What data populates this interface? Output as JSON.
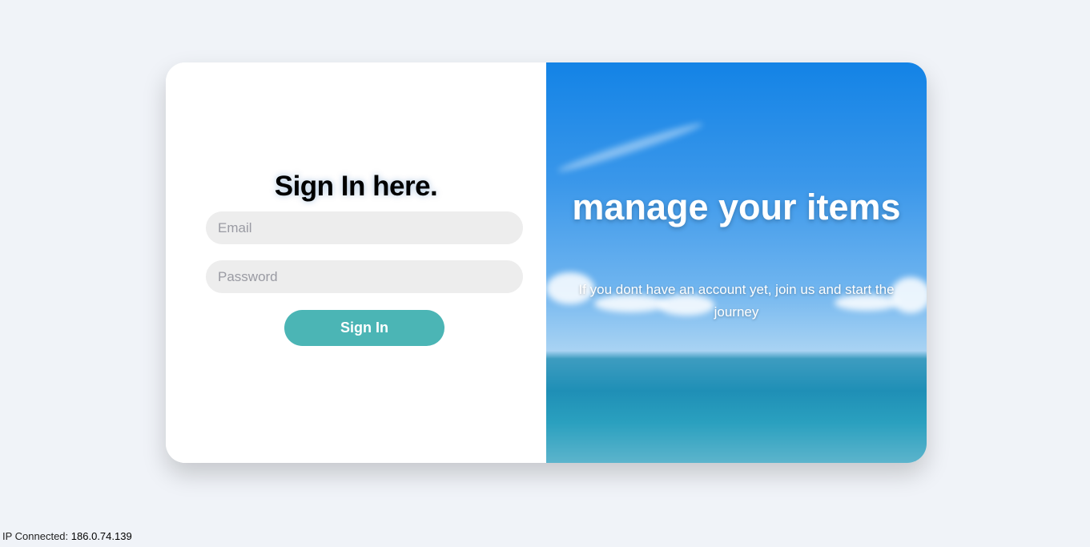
{
  "signin": {
    "title": "Sign In here.",
    "email_placeholder": "Email",
    "password_placeholder": "Password",
    "submit_label": "Sign In",
    "accent_color": "#4bb5b5"
  },
  "promo": {
    "title": "manage your items",
    "subtitle": "If you dont have an account yet, join us and start the journey"
  },
  "footer": {
    "ip_label": "IP Connected:",
    "ip_value": "186.0.74.139"
  }
}
